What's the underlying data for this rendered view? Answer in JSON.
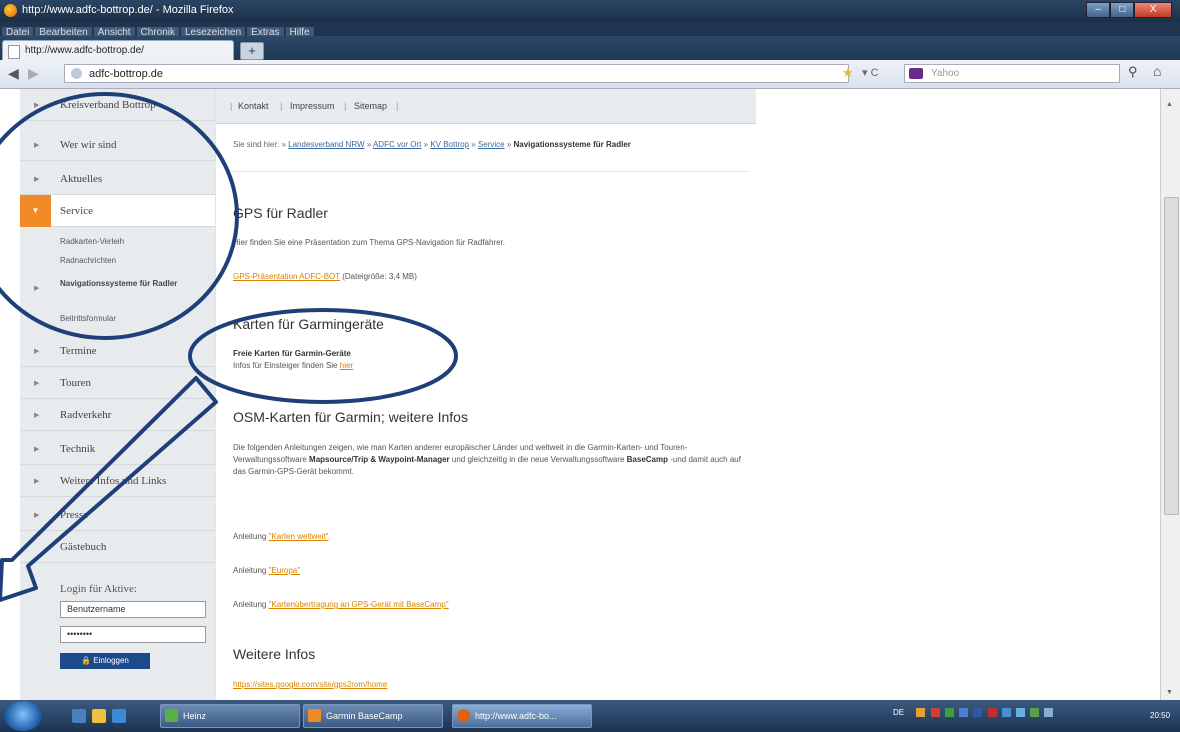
{
  "window": {
    "title": "http://www.adfc-bottrop.de/ - Mozilla Firefox",
    "controls": {
      "minimize": "–",
      "maximize": "□",
      "close": "X"
    }
  },
  "menu": [
    "Datei",
    "Bearbeiten",
    "Ansicht",
    "Chronik",
    "Lesezeichen",
    "Extras",
    "Hilfe"
  ],
  "tabs": [
    {
      "label": "http://www.adfc-bottrop.de/"
    }
  ],
  "new_tab_label": "+",
  "nav": {
    "back": "◀",
    "forward": "▶",
    "url": "adfc-bottrop.de",
    "search_placeholder": "Yahoo"
  },
  "sidebar": {
    "items": [
      {
        "label": "Kreisverband Bottrop"
      },
      {
        "label": "Wer wir sind"
      },
      {
        "label": "Aktuelles"
      },
      {
        "label": "Service",
        "active": true
      },
      {
        "label": "Termine"
      },
      {
        "label": "Touren"
      },
      {
        "label": "Radverkehr"
      },
      {
        "label": "Technik"
      },
      {
        "label": "Weitere Infos und Links"
      },
      {
        "label": "Presse"
      },
      {
        "label": "Gästebuch"
      }
    ],
    "sub_items": [
      {
        "label": "Radkarten-Verleih"
      },
      {
        "label": "Radnachrichten"
      },
      {
        "label": "Navigationssysteme für Radler"
      },
      {
        "label": "Beitrittsformular"
      }
    ],
    "login": {
      "title": "Login für Aktive:",
      "username_placeholder": "Benutzername",
      "password_value": "••••••••",
      "button_label": "Einloggen"
    }
  },
  "topbar": {
    "links": [
      "Kontakt",
      "Impressum",
      "Sitemap"
    ]
  },
  "breadcrumb": {
    "prefix": "Sie sind hier:",
    "links": [
      "Landesverband NRW",
      "ADFC vor Ort",
      "KV Bottrop",
      "Service"
    ],
    "current": "Navigationssysteme für Radler"
  },
  "content": {
    "sections": [
      {
        "heading": "GPS für Radler",
        "text": "Hier finden Sie eine Präsentation zum Thema GPS-Navigation für Radfahrer.",
        "link": "GPS-Präsentation ADFC-BOT",
        "link_suffix": "(Dateigröße: 3,4 MB)"
      },
      {
        "heading": "Karten für Garmingeräte",
        "bold_line": "Freie Karten für Garmin-Geräte",
        "text_prefix": "Infos für Einsteiger finden Sie",
        "link": "hier"
      },
      {
        "heading": "OSM-Karten für Garmin; weitere Infos",
        "paragraph_1": "Die folgenden Anleitungen zeigen, wie man Karten anderer europäischer Länder und weltweit in die Garmin-Karten- und Touren-Verwaltungssoftware ",
        "bold_1": "Mapsource/Trip & Waypoint-Manager",
        "paragraph_2": " und gleichzeitig in die neue Verwaltungssoftware ",
        "bold_2": "BaseCamp",
        "paragraph_3": " -und damit auch auf das Garmin-GPS-Gerät bekommt.",
        "instructions": [
          {
            "prefix": "Anleitung",
            "link": "\"Karten weltweit\""
          },
          {
            "prefix": "Anleitung",
            "link": "\"Europa\""
          },
          {
            "prefix": "Anleitung",
            "link": "\"Kartenübertragung an GPS-Gerät mit BaseCamp\""
          }
        ]
      },
      {
        "heading": "Weitere Infos",
        "link": "https://sites.google.com/site/gps2rom/home"
      }
    ]
  },
  "taskbar": {
    "buttons": [
      {
        "label": "Heinz"
      },
      {
        "label": "Garmin BaseCamp"
      },
      {
        "label": "http://www.adfc-bo..."
      }
    ],
    "tray_text": "DE",
    "clock": "20:50"
  },
  "colors": {
    "accent_orange": "#f08a24",
    "annotation_blue": "#1f3f78",
    "link_orange": "#d98200",
    "login_button": "#1d4a8a"
  }
}
